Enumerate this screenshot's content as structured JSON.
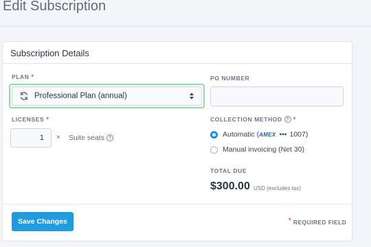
{
  "page": {
    "title": "Edit Subscription"
  },
  "card": {
    "title": "Subscription Details"
  },
  "plan": {
    "label": "PLAN",
    "required_mark": "*",
    "value": "Professional Plan (annual)"
  },
  "po_number": {
    "label": "PO NUMBER",
    "value": ""
  },
  "licenses": {
    "label": "LICENSES",
    "required_mark": "*",
    "quantity": "1",
    "times": "×",
    "unit": "Suite seats",
    "help": "?"
  },
  "collection_method": {
    "label": "COLLECTION METHOD",
    "help": "?",
    "required_mark": "*",
    "options": [
      {
        "prefix": "Automatic (",
        "card_brand": "AMEX",
        "dots": "•••",
        "last4": "1007",
        "suffix": ")",
        "checked": true
      },
      {
        "label": "Manual invoicing (Net 30)",
        "checked": false
      }
    ]
  },
  "total": {
    "label": "TOTAL DUE",
    "amount": "$300.00",
    "note": "USD (excludes tax)"
  },
  "footer": {
    "save_label": "Save Changes",
    "required_mark": "*",
    "required_note": "REQUIRED FIELD"
  },
  "colors": {
    "accent": "#1f9be0",
    "focus_border": "#8be0a8",
    "required": "#e0505a"
  }
}
